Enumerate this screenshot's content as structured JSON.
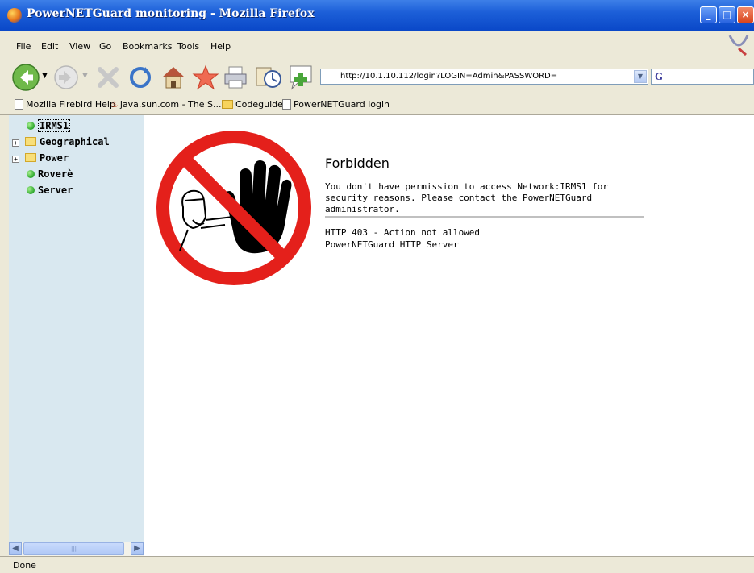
{
  "window": {
    "title": "PowerNETGuard monitoring - Mozilla Firefox"
  },
  "menu": [
    "File",
    "Edit",
    "View",
    "Go",
    "Bookmarks",
    "Tools",
    "Help"
  ],
  "address": {
    "url": "http://10.1.10.112/login?LOGIN=Admin&PASSWORD="
  },
  "search": {
    "engine_icon": "G"
  },
  "bookmarks": [
    "Mozilla Firebird Help",
    "java.sun.com - The S...",
    "Codeguide",
    "PowerNETGuard login"
  ],
  "tree": [
    {
      "label": "IRMS1",
      "kind": "node",
      "expandable": false,
      "selected": true
    },
    {
      "label": "Geographical",
      "kind": "folder",
      "expandable": true
    },
    {
      "label": "Power",
      "kind": "folder",
      "expandable": true
    },
    {
      "label": "Roverè",
      "kind": "node",
      "expandable": false
    },
    {
      "label": "Server",
      "kind": "node",
      "expandable": false
    }
  ],
  "content": {
    "title": "Forbidden",
    "message": "You don't have permission to access Network:IRMS1 for security reasons. Please contact the PowerNETGuard administrator.",
    "footer_line1": "HTTP 403 - Action not allowed",
    "footer_line2": "PowerNETGuard HTTP Server"
  },
  "status": {
    "text": "Done"
  },
  "colors": {
    "titlebar": "#0a48c8",
    "sidebar": "#d9e8f0",
    "node_dot": "#2aa62a",
    "stop_red": "#e4201b"
  }
}
